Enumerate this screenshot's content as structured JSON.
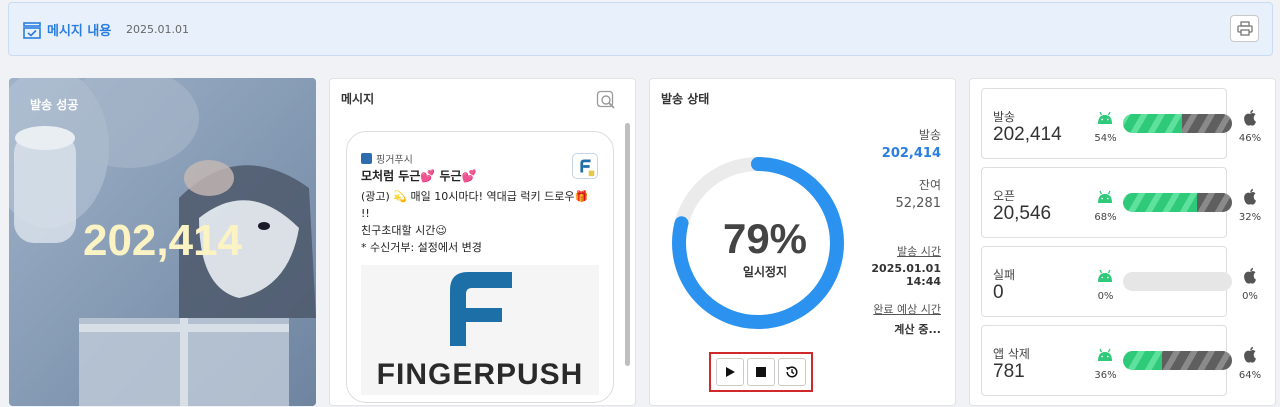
{
  "header": {
    "title": "메시지 내용",
    "date": "2025.01.01"
  },
  "card_send_success": {
    "label": "발송 성공",
    "value": "202,414"
  },
  "card_message": {
    "title": "메시지",
    "app_name": "핑거푸시",
    "lines": [
      "모처럼 두근💕 두근💕",
      "(광고) 💫 매일 10시마다! 역대급 럭키 드로우🎁",
      "!!",
      "친구초대할 시간😉",
      "* 수신거부: 설정에서 변경"
    ],
    "image_brand": "FINGERPUSH"
  },
  "card_status": {
    "title": "발송 상태",
    "progress_percent": 79,
    "progress_text": "79%",
    "progress_label": "일시정지",
    "sent_label": "발송",
    "sent_value": "202,414",
    "remaining_label": "잔여",
    "remaining_value": "52,281",
    "send_time_label": "발송 시간",
    "send_time_date": "2025.01.01",
    "send_time_time": "14:44",
    "eta_label": "완료 예상 시간",
    "eta_value": "계산 중...",
    "controls": [
      "play-icon",
      "stop-icon",
      "history-icon"
    ]
  },
  "stats": [
    {
      "label": "발송",
      "value": "202,414",
      "android_pct": 54,
      "ios_pct": 46,
      "android_text": "54%",
      "ios_text": "46%"
    },
    {
      "label": "오픈",
      "value": "20,546",
      "android_pct": 68,
      "ios_pct": 32,
      "android_text": "68%",
      "ios_text": "32%"
    },
    {
      "label": "실패",
      "value": "0",
      "android_pct": 0,
      "ios_pct": 0,
      "android_text": "0%",
      "ios_text": "0%"
    },
    {
      "label": "앱 삭제",
      "value": "781",
      "android_pct": 36,
      "ios_pct": 64,
      "android_text": "36%",
      "ios_text": "64%"
    }
  ],
  "colors": {
    "accent": "#2a7de1",
    "ring": "#2b93ef",
    "ring_track": "#ebebeb",
    "android": "#2fc97a",
    "ios": "#666666",
    "highlight": "#d0282b"
  }
}
